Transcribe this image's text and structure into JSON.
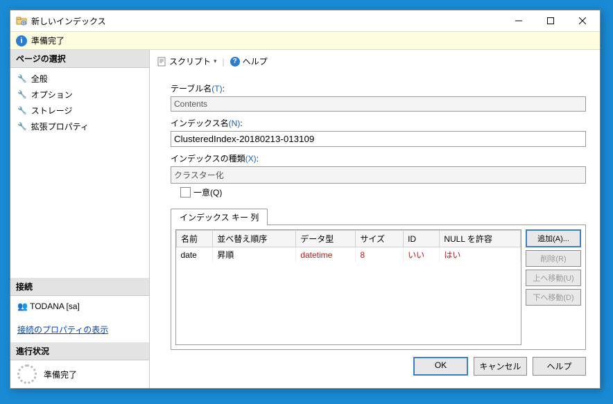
{
  "window": {
    "title": "新しいインデックス"
  },
  "status": {
    "text": "準備完了"
  },
  "sidebar": {
    "header": "ページの選択",
    "items": [
      {
        "label": "全般"
      },
      {
        "label": "オプション"
      },
      {
        "label": "ストレージ"
      },
      {
        "label": "拡張プロパティ"
      }
    ]
  },
  "connection": {
    "header": "接続",
    "server": "TODANA [sa]",
    "view_props": "接続のプロパティの表示"
  },
  "progress": {
    "header": "進行状況",
    "text": "準備完了"
  },
  "toolbar": {
    "script": "スクリプト",
    "help": "ヘルプ"
  },
  "form": {
    "table_label": "テーブル名",
    "table_hotkey": "(T)",
    "table_value": "Contents",
    "index_label": "インデックス名",
    "index_hotkey": "(N)",
    "index_value": "ClusteredIndex-20180213-013109",
    "type_label": "インデックスの種類",
    "type_hotkey": "(X)",
    "type_value": "クラスター化",
    "unique_label": "一意(Q)"
  },
  "tab": {
    "keycols": "インデックス キー 列"
  },
  "grid": {
    "cols": {
      "name": "名前",
      "sort": "並べ替え順序",
      "type": "データ型",
      "size": "サイズ",
      "id": "ID",
      "nulls": "NULL を許容"
    },
    "rows": [
      {
        "name": "date",
        "sort": "昇順",
        "type": "datetime",
        "size": "8",
        "id": "いい",
        "nulls": "はい"
      }
    ]
  },
  "btns": {
    "add": "追加(A)...",
    "remove": "削除(R)",
    "up": "上へ移動(U)",
    "down": "下へ移動(D)"
  },
  "footer": {
    "ok": "OK",
    "cancel": "キャンセル",
    "help": "ヘルプ"
  }
}
